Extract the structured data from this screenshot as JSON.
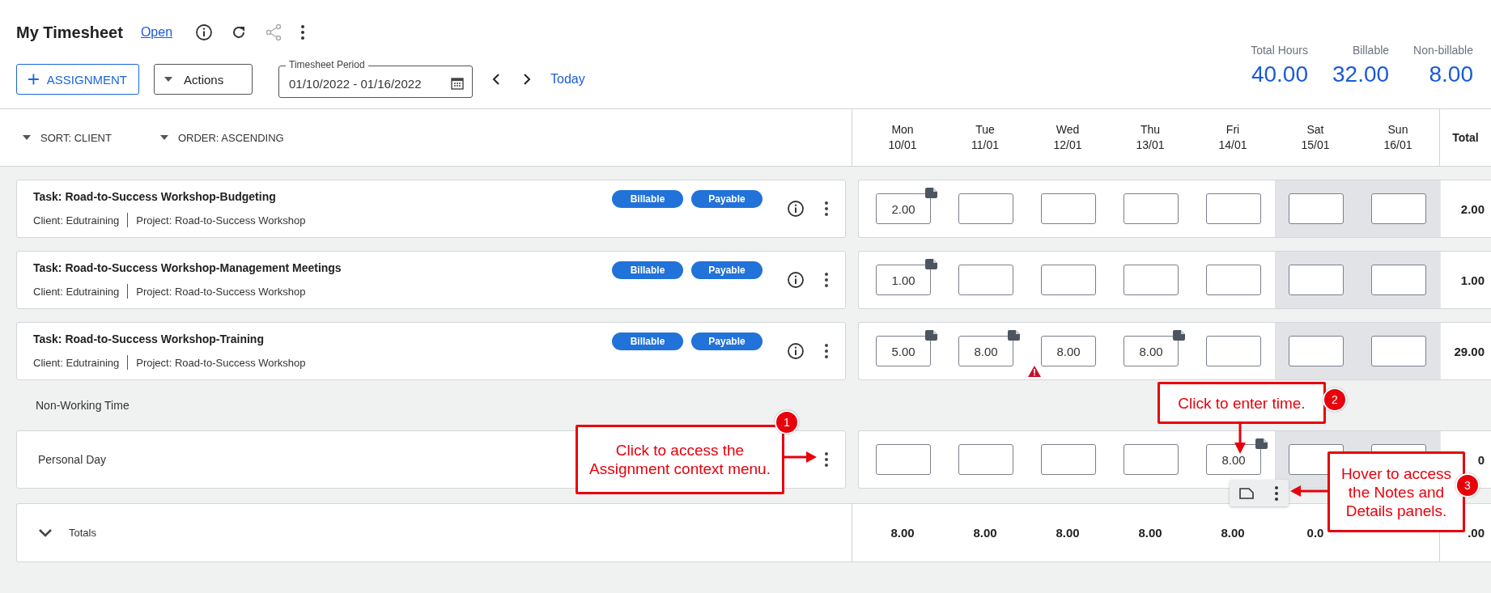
{
  "header": {
    "title": "My Timesheet",
    "status": "Open"
  },
  "toolbar": {
    "add_button": "ASSIGNMENT",
    "actions": "Actions",
    "period": {
      "label": "Timesheet Period",
      "value": "01/10/2022 - 01/16/2022"
    },
    "today": "Today"
  },
  "summary": [
    {
      "label": "Total Hours",
      "value": "40.00"
    },
    {
      "label": "Billable",
      "value": "32.00"
    },
    {
      "label": "Non-billable",
      "value": "8.00"
    }
  ],
  "sort": {
    "sort": "SORT: CLIENT",
    "order": "ORDER: ASCENDING"
  },
  "days": [
    {
      "day": "Mon",
      "date": "10/01",
      "weekend": false
    },
    {
      "day": "Tue",
      "date": "11/01",
      "weekend": false
    },
    {
      "day": "Wed",
      "date": "12/01",
      "weekend": false
    },
    {
      "day": "Thu",
      "date": "13/01",
      "weekend": false
    },
    {
      "day": "Fri",
      "date": "14/01",
      "weekend": false
    },
    {
      "day": "Sat",
      "date": "15/01",
      "weekend": true
    },
    {
      "day": "Sun",
      "date": "16/01",
      "weekend": true
    }
  ],
  "total_heading": "Total",
  "rows": [
    {
      "kind": "task",
      "title": "Task: Road-to-Success Workshop-Budgeting",
      "client": "Client: Edutraining",
      "project": "Project: Road-to-Success Workshop",
      "tags": [
        "Billable",
        "Payable"
      ],
      "total": "2.00",
      "cells": [
        {
          "value": "2.00",
          "note": true,
          "warning": false
        },
        {
          "note": false,
          "warning": false
        },
        {
          "note": false,
          "warning": false
        },
        {
          "note": false,
          "warning": false
        },
        {
          "note": false,
          "warning": false
        },
        {
          "note": false,
          "warning": false
        },
        {
          "note": false,
          "warning": false
        }
      ]
    },
    {
      "kind": "task",
      "title": "Task: Road-to-Success Workshop-Management Meetings",
      "client": "Client: Edutraining",
      "project": "Project: Road-to-Success Workshop",
      "tags": [
        "Billable",
        "Payable"
      ],
      "total": "1.00",
      "cells": [
        {
          "value": "1.00",
          "note": true,
          "warning": false
        },
        {
          "note": false,
          "warning": false
        },
        {
          "note": false,
          "warning": false
        },
        {
          "note": false,
          "warning": false
        },
        {
          "note": false,
          "warning": false
        },
        {
          "note": false,
          "warning": false
        },
        {
          "note": false,
          "warning": false
        }
      ]
    },
    {
      "kind": "task",
      "title": "Task: Road-to-Success Workshop-Training",
      "client": "Client: Edutraining",
      "project": "Project: Road-to-Success Workshop",
      "tags": [
        "Billable",
        "Payable"
      ],
      "total": "29.00",
      "cells": [
        {
          "value": "5.00",
          "note": true,
          "warning": false
        },
        {
          "value": "8.00",
          "note": true,
          "warning": false
        },
        {
          "value": "8.00",
          "note": false,
          "warning": true
        },
        {
          "value": "8.00",
          "note": true,
          "warning": false
        },
        {
          "note": false,
          "warning": false
        },
        {
          "note": false,
          "warning": false
        },
        {
          "note": false,
          "warning": false
        }
      ]
    },
    {
      "kind": "section",
      "title": "Non-Working Time"
    },
    {
      "kind": "time_off",
      "title": "Personal Day",
      "total": "0",
      "cells": [
        {
          "note": false,
          "warning": false
        },
        {
          "note": false,
          "warning": false
        },
        {
          "note": false,
          "warning": false
        },
        {
          "note": false,
          "warning": false
        },
        {
          "value": "8.00",
          "note": true,
          "warning": false
        },
        {
          "note": false,
          "warning": false
        },
        {}
      ]
    }
  ],
  "totals": {
    "label": "Totals",
    "expanded": false,
    "values": [
      "8.00",
      "8.00",
      "8.00",
      "8.00",
      "8.00",
      "0.0"
    ],
    "total": ".00"
  },
  "callouts": [
    {
      "number": "1",
      "text": "Click to access the Assignment context menu."
    },
    {
      "number": "2",
      "text": "Click to enter time."
    },
    {
      "number": "3",
      "text": "Hover to access the Notes and Details panels."
    }
  ]
}
